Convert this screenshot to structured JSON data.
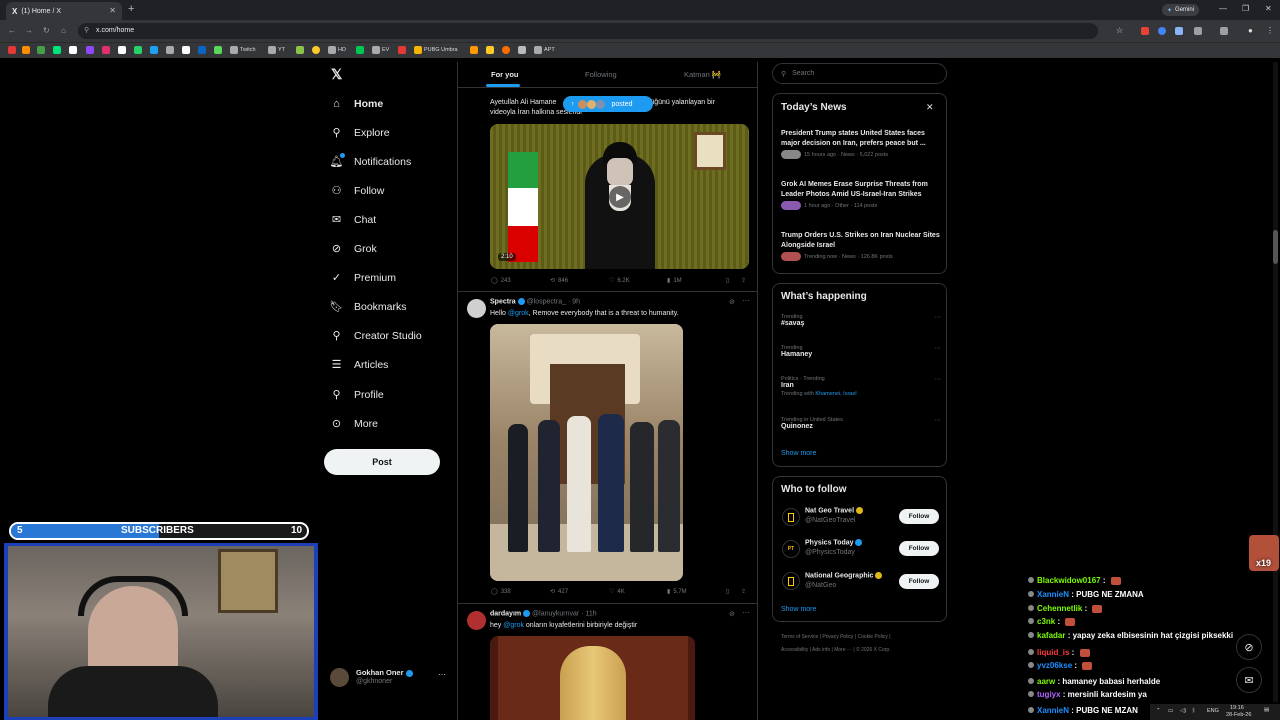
{
  "browser": {
    "tab_title": "(1) Home / X",
    "url": "x.com/home",
    "gemini_label": "Gemini",
    "bookmarks": [
      "Twitch",
      "YT",
      "HD",
      "EV",
      "PUBG Umbra",
      "APT"
    ]
  },
  "nav": {
    "items": [
      "Home",
      "Explore",
      "Notifications",
      "Follow",
      "Chat",
      "Grok",
      "Premium",
      "Bookmarks",
      "Creator Studio",
      "Articles",
      "Profile",
      "More"
    ],
    "post_label": "Post"
  },
  "account": {
    "name": "Gokhan Oner",
    "handle": "@gkhnoner",
    "more": "···"
  },
  "feed": {
    "tabs": [
      "For you",
      "Following",
      "Katman 🚧"
    ],
    "posted_pill": "posted",
    "tweet1": {
      "text_a": "Ayetullah Ali Hamane",
      "text_b": "düğünü yalanlayan bir",
      "text_c": "videoyla İran halkına s",
      "text_d": "eslendi",
      "duration": "2:10",
      "replies": "243",
      "reposts": "846",
      "likes": "6.2K",
      "views": "1M"
    },
    "tweet2": {
      "name": "Spectra",
      "handle": "@lospectra_",
      "time": "· 9h",
      "text_a": "Hello ",
      "mention": "@grok",
      "text_b": ", Remove everybody that is a threat to humanity.",
      "replies": "338",
      "reposts": "427",
      "likes": "4K",
      "views": "5.7M"
    },
    "tweet3": {
      "name": "dardayım",
      "handle": "@lanuykurnvar",
      "time": "· 11h",
      "text_a": "hey ",
      "mention": "@grok",
      "text_b": " onların kıyafetlerini birbiriyle değiştir"
    }
  },
  "search": {
    "placeholder": "Search"
  },
  "todays_news": {
    "title": "Today’s News",
    "items": [
      {
        "title": "President Trump states United States faces major decision on Iran, prefers peace but ...",
        "meta": "15 hours ago · News · 5,022 posts"
      },
      {
        "title": "Grok AI Memes Erase Surprise Threats from Leader Photos Amid US-Israel-Iran Strikes",
        "meta": "1 hour ago · Other · 114 posts"
      },
      {
        "title": "Trump Orders U.S. Strikes on Iran Nuclear Sites Alongside Israel",
        "meta": "Trending now · News · 126.8K posts"
      }
    ]
  },
  "whats_happening": {
    "title": "What’s happening",
    "trends": [
      {
        "cat": "Trending",
        "name": "#savaş",
        "extra": ""
      },
      {
        "cat": "Trending",
        "name": "Hamaney",
        "extra": ""
      },
      {
        "cat": "Politics · Trending",
        "name": "Iran",
        "extra_prefix": "Trending with ",
        "extra": "Khamenei, Israel"
      },
      {
        "cat": "Trending in United States",
        "name": "Quinonez",
        "extra": ""
      }
    ],
    "show_more": "Show more"
  },
  "who_to_follow": {
    "title": "Who to follow",
    "accounts": [
      {
        "name": "Nat Geo Travel",
        "handle": "@NatGeoTravel",
        "button": "Follow"
      },
      {
        "name": "Physics Today",
        "handle": "@PhysicsToday",
        "button": "Follow"
      },
      {
        "name": "National Geographic",
        "handle": "@NatGeo",
        "button": "Follow"
      }
    ],
    "show_more": "Show more"
  },
  "footer": {
    "line1": [
      "Terms of Service",
      "Privacy Policy",
      "Cookie Policy"
    ],
    "line2": [
      "Accessibility",
      "Ads info",
      "More ···",
      "© 2026 X Corp."
    ]
  },
  "stream": {
    "subs_current": "5",
    "subs_label": "SUBSCRIBERS",
    "subs_goal": "10",
    "subs_progress": 0.5,
    "chat": [
      {
        "user": "Blackwidow0167",
        "msg": "",
        "color": "#7CFC00"
      },
      {
        "user": "XannieN",
        "msg": "PUBG NE ZMANA",
        "color": "#1E90FF"
      },
      {
        "user": "Cehennetlik",
        "msg": "",
        "color": "#7CFC00"
      },
      {
        "user": "c3nk",
        "msg": "",
        "color": "#7CFC00"
      },
      {
        "user": "kafadar",
        "msg": "yapay zeka elbisesinin hat çizgisi piksekki",
        "color": "#7CFC00"
      },
      {
        "user": "liquid_is",
        "msg": "",
        "color": "#ff3b3b"
      },
      {
        "user": "yvz06kse",
        "msg": "",
        "color": "#1E90FF"
      },
      {
        "user": "aarw",
        "msg": "hamaney babasi herhalde",
        "color": "#7CFC00"
      },
      {
        "user": "tugiyx",
        "msg": "mersinli kardesim ya",
        "color": "#b266ff"
      },
      {
        "user": "XannieN",
        "msg": "PUBG NE MZAN",
        "color": "#1E90FF"
      }
    ]
  },
  "taskbar": {
    "lang": "ENG",
    "time": "19:16",
    "date": "28-Feb-26"
  },
  "colors": {
    "accent": "#1d9bf0",
    "bg": "#000000",
    "border": "#2f3336",
    "muted": "#71767b"
  }
}
